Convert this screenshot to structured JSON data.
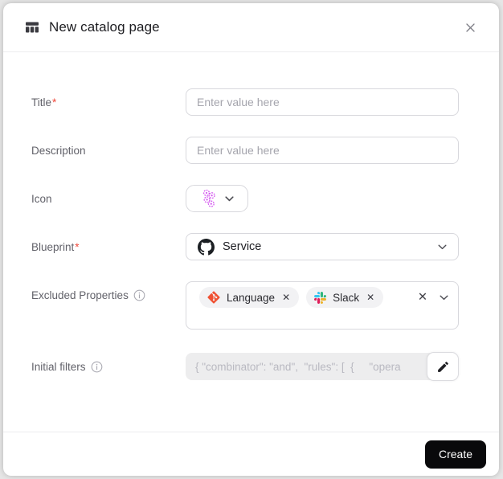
{
  "header": {
    "title": "New catalog page",
    "icon": "table-icon"
  },
  "form": {
    "title": {
      "label": "Title",
      "required_mark": "*",
      "placeholder": "Enter value here",
      "value": ""
    },
    "description": {
      "label": "Description",
      "placeholder": "Enter value here",
      "value": ""
    },
    "icon": {
      "label": "Icon",
      "selected_icon": "microservices-icon",
      "icon_color": "#d55bf0"
    },
    "blueprint": {
      "label": "Blueprint",
      "required_mark": "*",
      "value": "Service",
      "value_icon": "github-icon"
    },
    "excluded_properties": {
      "label": "Excluded Properties",
      "chips": [
        {
          "label": "Language",
          "icon": "git-icon",
          "dismiss": "✕"
        },
        {
          "label": "Slack",
          "icon": "slack-icon",
          "dismiss": "✕"
        }
      ],
      "clear": "✕"
    },
    "initial_filters": {
      "label": "Initial filters",
      "value": "{ \"combinator\": \"and\",  \"rules\": [  {     \"opera",
      "disabled": true
    }
  },
  "footer": {
    "create_label": "Create"
  },
  "colors": {
    "accent_purple": "#d55bf0",
    "git_orange": "#f05133",
    "required_red": "#ef4a3c",
    "button_black": "#09090b",
    "slack_blue": "#36C5F0",
    "slack_green": "#2EB67D",
    "slack_yellow": "#ECB22E",
    "slack_red": "#E01E5A"
  }
}
